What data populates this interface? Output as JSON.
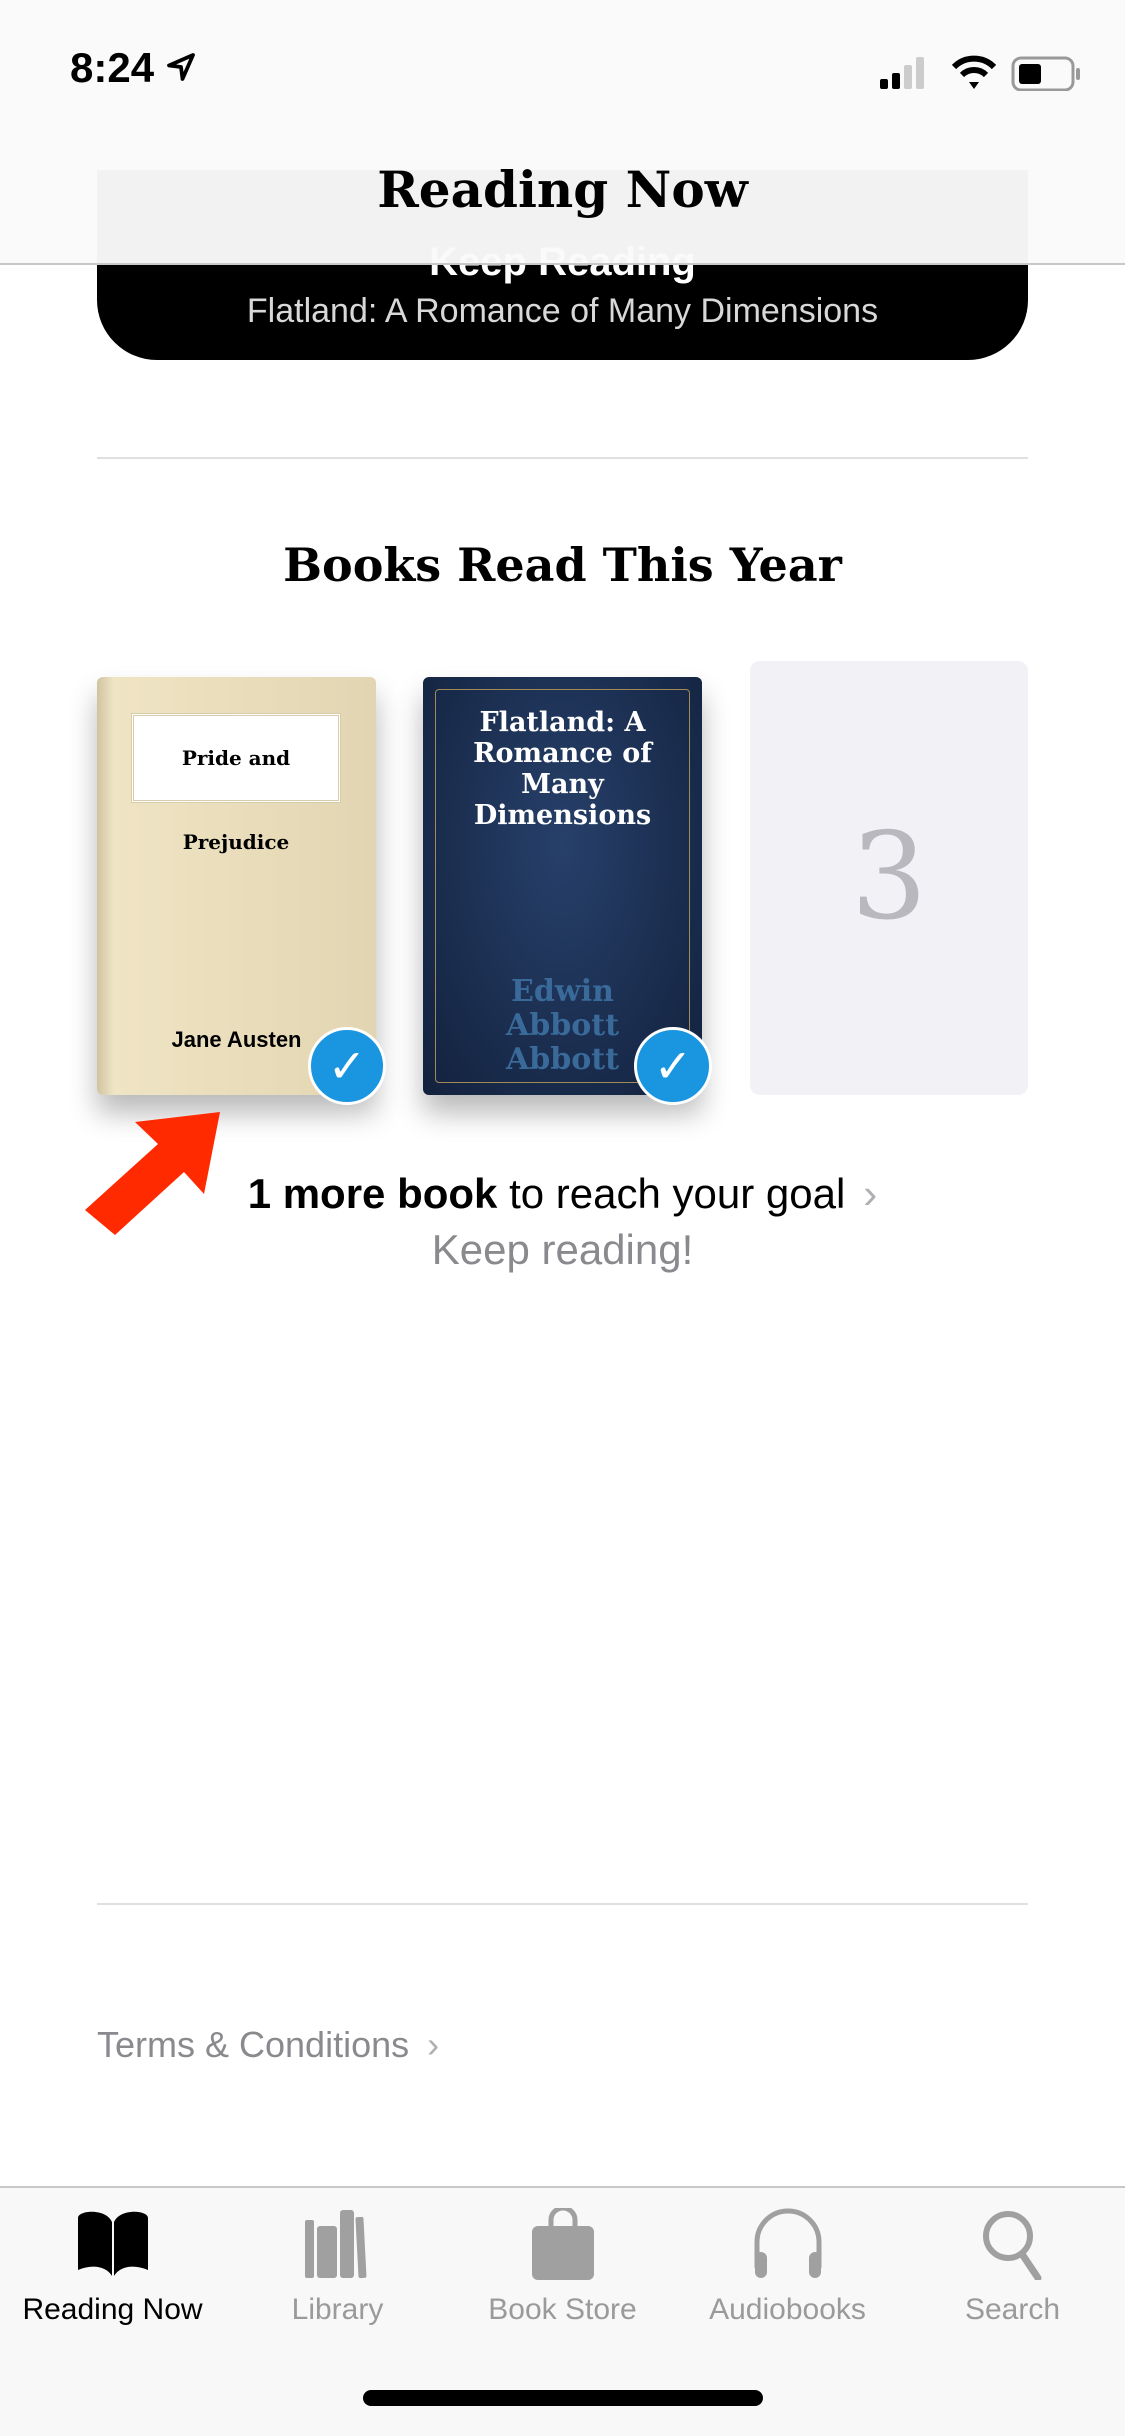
{
  "status_bar": {
    "time": "8:24",
    "location-icon": "location-arrow-icon",
    "signal": "cellular-signal-icon",
    "wifi": "wifi-icon",
    "battery": "battery-icon"
  },
  "header": {
    "title": "Reading Now"
  },
  "keep_reading": {
    "label": "Keep Reading",
    "book": "Flatland: A Romance of Many Dimensions"
  },
  "books_read": {
    "title": "Books Read This Year",
    "books": [
      {
        "title": "Pride and Prejudice",
        "author": "Jane Austen",
        "finished": true
      },
      {
        "title": "Flatland: A Romance of Many Dimensions",
        "author": "Edwin Abbott Abbott",
        "finished": true
      }
    ],
    "next_slot": "3",
    "goal_bold": "1 more book",
    "goal_rest": " to reach your goal",
    "encouragement": "Keep reading!",
    "check_color": "#1a95e0"
  },
  "annotation": {
    "color": "#ff2a00"
  },
  "footer": {
    "terms": "Terms & Conditions"
  },
  "tabs": [
    {
      "label": "Reading Now",
      "icon": "open-book-icon",
      "active": true
    },
    {
      "label": "Library",
      "icon": "library-icon"
    },
    {
      "label": "Book Store",
      "icon": "shopping-bag-icon"
    },
    {
      "label": "Audiobooks",
      "icon": "headphones-icon"
    },
    {
      "label": "Search",
      "icon": "search-icon"
    }
  ]
}
